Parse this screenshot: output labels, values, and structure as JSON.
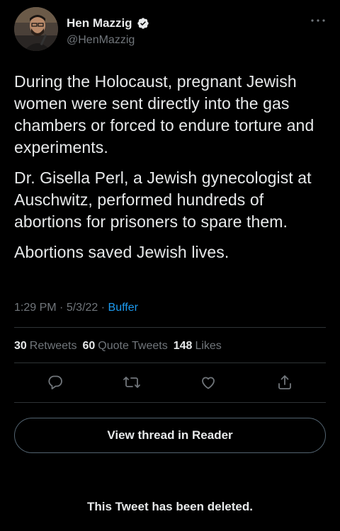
{
  "author": {
    "display_name": "Hen Mazzig",
    "handle": "@HenMazzig",
    "verified": true
  },
  "tweet": {
    "paragraphs": [
      "During the Holocaust, pregnant Jewish women were sent directly into the gas chambers or forced to endure torture and experiments.",
      "Dr. Gisella Perl, a Jewish gynecologist at Auschwitz, performed hundreds of abortions for prisoners to spare them.",
      "Abortions saved Jewish lives."
    ],
    "time": "1:29 PM",
    "date": "5/3/22",
    "separator": "·",
    "source": "Buffer"
  },
  "stats": {
    "retweets_count": "30",
    "retweets_label": "Retweets",
    "quotes_count": "60",
    "quotes_label": "Quote Tweets",
    "likes_count": "148",
    "likes_label": "Likes"
  },
  "actions": {
    "icons": [
      "reply-icon",
      "retweet-icon",
      "like-icon",
      "share-icon"
    ]
  },
  "reader_button_label": "View thread in Reader",
  "deleted_notice": "This Tweet has been deleted.",
  "colors": {
    "background": "#000000",
    "text": "#e7e9ea",
    "secondary": "#71767b",
    "accent": "#1d9bf0"
  }
}
